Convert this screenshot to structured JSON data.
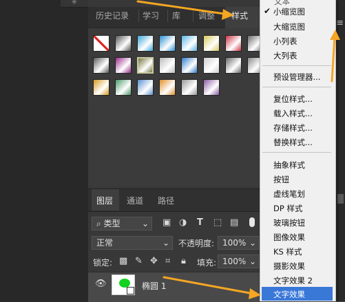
{
  "panel_tabs": [
    "历史记录",
    "学习",
    "库",
    "调整",
    "样式"
  ],
  "styles_swatches": [
    [
      "#ffffff",
      "#555555",
      "#3aa6d8",
      "#2b8fd2",
      "#5ab5e6",
      "#d8c85a",
      "#cc3344",
      "#6a6a6a"
    ],
    [
      "#5a5a5a",
      "#9a2c8a",
      "#777744",
      "#bbbbbb",
      "#2e7cc8",
      "#cfcfcf",
      "#6a6a6a",
      "#888888"
    ],
    [
      "#d89b1e",
      "#4a9a6a",
      "#5a8fcf",
      "#e08e2a",
      "#999999",
      "#8a5aa0"
    ]
  ],
  "layers_tabs": [
    "图层",
    "通道",
    "路径"
  ],
  "filter_kind": "类型",
  "blend_mode": "正常",
  "opacity_label": "不透明度:",
  "opacity_value": "100%",
  "lock_label": "锁定:",
  "fill_label": "填充:",
  "fill_value": "100%",
  "layer_name": "椭圆 1",
  "menu": {
    "top_partial": "文本",
    "view_items": [
      "小缩览图",
      "大缩览图",
      "小列表",
      "大列表"
    ],
    "checked_index": 0,
    "manager": "预设管理器...",
    "style_ops": [
      "复位样式...",
      "载入样式...",
      "存储样式...",
      "替换样式..."
    ],
    "libraries": [
      "抽象样式",
      "按钮",
      "虚线笔划",
      "DP 样式",
      "玻璃按钮",
      "图像效果",
      "KS 样式",
      "摄影效果",
      "文字效果 2",
      "文字效果"
    ],
    "highlighted": "文字效果"
  },
  "colors": {
    "highlight": "#3a78d8",
    "arrow": "#f5a623"
  }
}
